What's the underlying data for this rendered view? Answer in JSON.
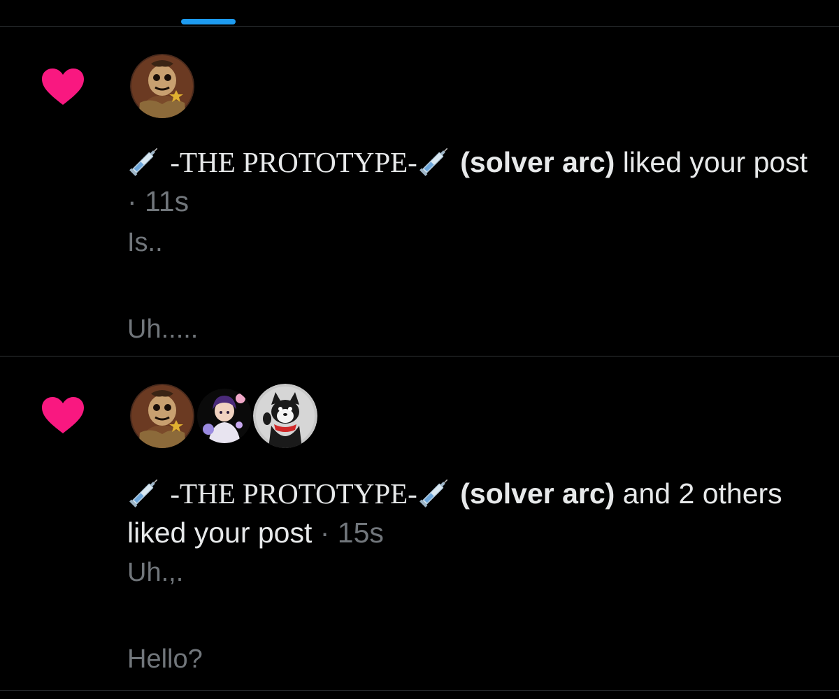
{
  "colors": {
    "background": "#000000",
    "accent": "#1d9bf0",
    "heart": "#f91880",
    "divider": "#2f3336",
    "muted_text": "#71767b",
    "primary_text": "#e7e9ea"
  },
  "header": {
    "active_tab_indicator": "tab-underline"
  },
  "notifications": [
    {
      "icon": "heart-icon",
      "avatars": [
        "avatar-pumpkin-scarecrow"
      ],
      "display_name": "-THE PROTOTYPE-",
      "handle_note": "(solver arc)",
      "action_text": " liked your post",
      "separator": " · ",
      "time": "11s",
      "preview_line1": "Is..",
      "preview_line2": "Uh....."
    },
    {
      "icon": "heart-icon",
      "avatars": [
        "avatar-pumpkin-scarecrow",
        "avatar-anime-character",
        "avatar-wolf-mascot"
      ],
      "display_name": "-THE PROTOTYPE-",
      "handle_note": "(solver arc)",
      "action_text": " and 2 others liked your post",
      "separator": " · ",
      "time": "15s",
      "preview_line1": "Uh.,.",
      "preview_line2": "Hello?"
    }
  ]
}
